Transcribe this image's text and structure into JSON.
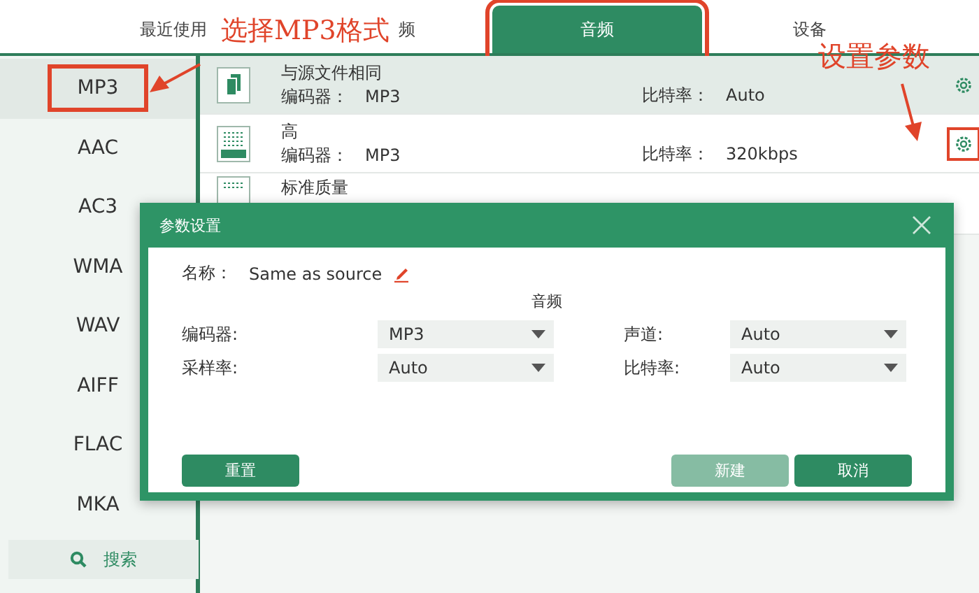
{
  "tabs": [
    {
      "label": "最近使用",
      "selected": false
    },
    {
      "label": "频",
      "selected": false
    },
    {
      "label": "音频",
      "selected": true,
      "highlighted": true
    },
    {
      "label": "设备",
      "selected": false
    }
  ],
  "sidebar": {
    "items": [
      {
        "label": "MP3",
        "selected": true,
        "highlighted": true
      },
      {
        "label": "AAC",
        "selected": false
      },
      {
        "label": "AC3",
        "selected": false
      },
      {
        "label": "WMA",
        "selected": false
      },
      {
        "label": "WAV",
        "selected": false
      },
      {
        "label": "AIFF",
        "selected": false
      },
      {
        "label": "FLAC",
        "selected": false
      },
      {
        "label": "MKA",
        "selected": false
      }
    ],
    "search_button": "搜索"
  },
  "presets": [
    {
      "kind": "copy",
      "title": "与源文件相同",
      "codec_label": "编码器：",
      "codec": "MP3",
      "bitrate_label": "比特率：",
      "bitrate": "Auto",
      "selected": true,
      "gear_highlighted": false
    },
    {
      "kind": "high",
      "title": "高",
      "codec_label": "编码器：",
      "codec": "MP3",
      "bitrate_label": "比特率：",
      "bitrate": "320kbps",
      "selected": false,
      "gear_highlighted": true
    },
    {
      "kind": "standard",
      "title": "标准质量",
      "selected": false
    }
  ],
  "dialog": {
    "title": "参数设置",
    "name_label": "名称：",
    "name_value": "Same as source",
    "section": "音频",
    "fields": [
      {
        "label": "编码器:",
        "value": "MP3"
      },
      {
        "label": "声道:",
        "value": "Auto"
      },
      {
        "label": "采样率:",
        "value": "Auto"
      },
      {
        "label": "比特率:",
        "value": "Auto"
      }
    ],
    "buttons": [
      {
        "label": "重置",
        "disabled": false,
        "kind": "left"
      },
      {
        "label": "新建",
        "disabled": true,
        "kind": "right"
      },
      {
        "label": "取消",
        "disabled": false,
        "kind": "right"
      }
    ]
  },
  "annotations": [
    {
      "kind": "callout",
      "text": "选择MP3格式"
    },
    {
      "kind": "callout",
      "text": "设置参数"
    }
  ]
}
